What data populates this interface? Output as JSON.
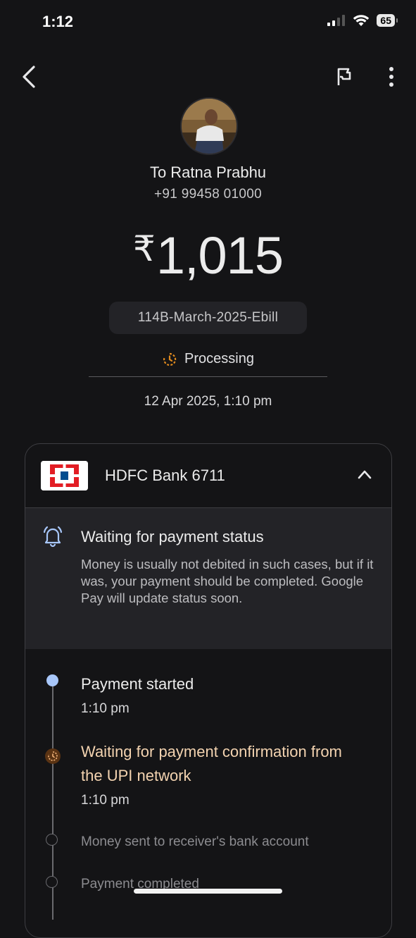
{
  "status_bar": {
    "time": "1:12",
    "battery": "65"
  },
  "recipient": {
    "to_label": "To Ratna Prabhu",
    "phone": "+91 99458 01000"
  },
  "payment": {
    "currency_symbol": "₹",
    "amount": "1,015",
    "note": "114B-March-2025-Ebill",
    "status": "Processing",
    "datetime": "12 Apr 2025, 1:10 pm"
  },
  "bank": {
    "name": "HDFC Bank 6711"
  },
  "notice": {
    "title": "Waiting for payment status",
    "body": "Money is usually not debited in such cases, but if it was, your payment should be completed. Google Pay will update status soon."
  },
  "timeline": {
    "started": {
      "title": "Payment started",
      "time": "1:10 pm"
    },
    "confirmation": {
      "title": "Waiting for payment confirmation from the UPI network",
      "time": "1:10 pm"
    },
    "sent": {
      "title": "Money sent to receiver's bank account"
    },
    "completed": {
      "title": "Payment completed"
    }
  },
  "colors": {
    "background": "#141416",
    "processing_accent": "#e08a1e",
    "started_dot": "#a8c7fa",
    "pending_text": "#f3d3b0",
    "hdfc_red": "#e21d24",
    "hdfc_blue": "#004c8f"
  },
  "icons": [
    "back-arrow-icon",
    "flag-icon",
    "more-vert-icon",
    "processing-clock-icon",
    "chevron-up-icon",
    "bell-icon"
  ]
}
